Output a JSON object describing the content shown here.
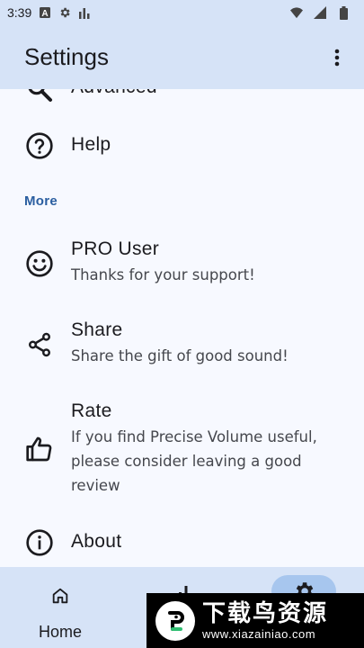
{
  "status_bar": {
    "time": "3:39",
    "icons_left": [
      "notification-a-icon",
      "settings-gear-icon",
      "bar-chart-icon"
    ],
    "icons_right": [
      "wifi-icon",
      "signal-icon",
      "battery-icon"
    ]
  },
  "app_bar": {
    "title": "Settings",
    "menu_icon": "more-vert-icon"
  },
  "list": {
    "advanced": {
      "label": "Advanced",
      "icon": "search-icon"
    },
    "help": {
      "label": "Help",
      "icon": "help-circle-icon"
    },
    "section_more": "More",
    "pro_user": {
      "label": "PRO User",
      "subtitle": "Thanks for your support!",
      "icon": "smiley-icon"
    },
    "share": {
      "label": "Share",
      "subtitle": "Share the gift of good sound!",
      "icon": "share-icon"
    },
    "rate": {
      "label": "Rate",
      "subtitle": "If you find Precise Volume useful, please consider leaving a good review",
      "icon": "thumb-up-icon"
    },
    "about": {
      "label": "About",
      "icon": "info-icon"
    }
  },
  "bottom_nav": {
    "home_label": "Home",
    "home_icon": "home-icon",
    "stats_icon": "equalizer-icon",
    "settings_icon": "settings-gear-icon",
    "selected": "settings"
  },
  "watermark": {
    "text": "下载鸟资源",
    "url": "www.xiazainiao.com"
  },
  "colors": {
    "bar_background": "#d6e3f7",
    "content_background": "#f7f9ff",
    "section_header": "#2a5ea0",
    "selected_pill": "#a7c6ee"
  }
}
